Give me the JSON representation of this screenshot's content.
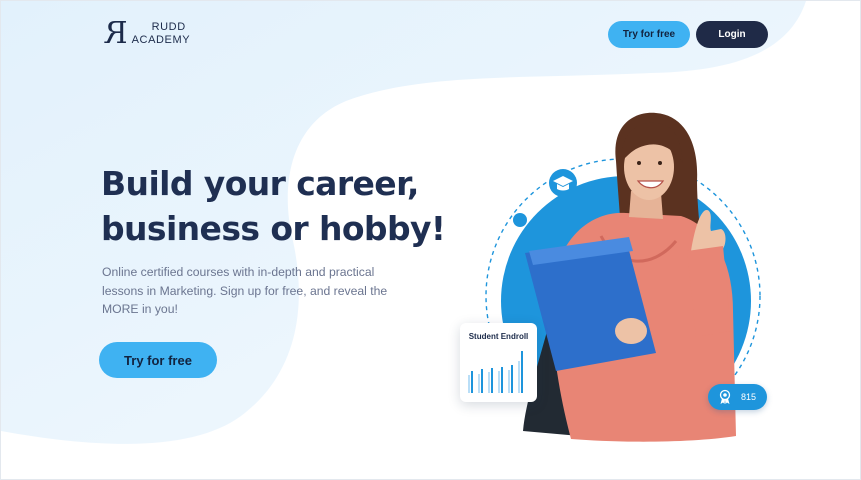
{
  "brand": {
    "mark": "R",
    "line1": "RUDD",
    "line2": "ACADEMY"
  },
  "header": {
    "try_label": "Try for free",
    "login_label": "Login"
  },
  "hero": {
    "title_line1": "Build your career,",
    "title_line2": "business or hobby!",
    "sub_line1": "Online certified courses with in-depth and practical",
    "sub_line2": "lessons in Marketing. Sign up for free, and reveal the",
    "sub_line3": "MORE in you!",
    "cta_label": "Try for free"
  },
  "illustration": {
    "card_title": "Student Endroll",
    "badge_value": "815",
    "icons": [
      "graduation-cap-icon",
      "award-ribbon-icon"
    ]
  },
  "colors": {
    "accent": "#3fb2f2",
    "navy": "#1f2a47",
    "circle": "#1e95dc",
    "text_dark": "#1f2f52",
    "text_muted": "#6b7590"
  }
}
